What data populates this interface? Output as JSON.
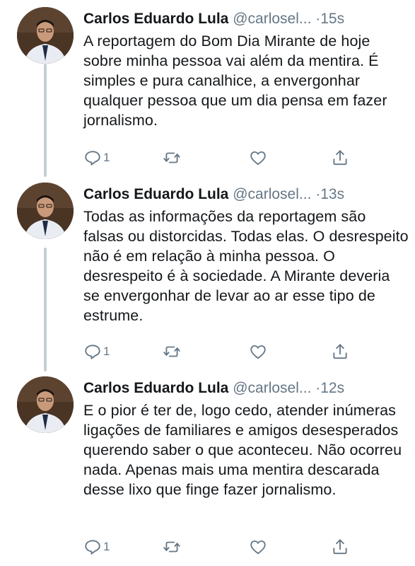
{
  "tweets": [
    {
      "name": "Carlos Eduardo Lula",
      "handle": "@carlosel...",
      "dot": "·",
      "time": "15s",
      "text": "A reportagem do Bom Dia Mirante de hoje sobre minha pessoa vai além da mentira. É simples e pura canalhice, a envergonhar qualquer pessoa que um dia pensa em fazer jornalismo.",
      "reply_count": "1"
    },
    {
      "name": "Carlos Eduardo Lula",
      "handle": "@carlosel...",
      "dot": "·",
      "time": "13s",
      "text": "Todas as informações da reportagem são falsas ou distorcidas. Todas elas. O desrespeito não é em relação à minha pessoa. O desrespeito é à sociedade. A Mirante deveria se envergonhar de levar ao ar esse tipo de estrume.",
      "reply_count": "1"
    },
    {
      "name": "Carlos Eduardo Lula",
      "handle": "@carlosel...",
      "dot": "·",
      "time": "12s",
      "text": "E o pior é ter de, logo cedo, atender inúmeras ligações de familiares e amigos desesperados querendo saber o que aconteceu. Não ocorreu nada. Apenas mais uma mentira descarada desse lixo que finge fazer jornalismo.",
      "reply_count": "1"
    }
  ],
  "icons": {
    "reply": "reply-icon",
    "retweet": "retweet-icon",
    "like": "heart-icon",
    "share": "share-icon"
  },
  "colors": {
    "text": "#14171a",
    "muted": "#657786",
    "thread_line": "#c4cfd6"
  }
}
